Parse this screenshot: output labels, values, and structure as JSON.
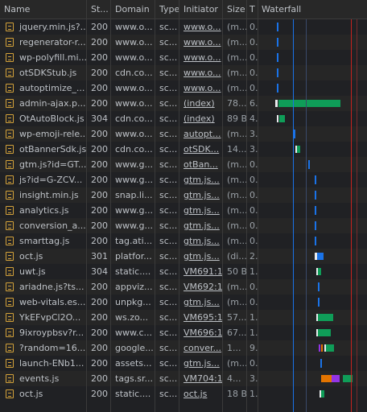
{
  "columns": {
    "name": "Name",
    "status": "St...",
    "domain": "Domain",
    "type": "Type",
    "initiator": "Initiator",
    "size": "Size",
    "time": "T",
    "waterfall": "Waterfall"
  },
  "colors": {
    "green": "#0f9d58",
    "blue": "#1a73e8",
    "wait": "#e8eaed",
    "orange": "#e37400",
    "purple": "#9334e6",
    "red": "#c5221f"
  },
  "rows": [
    {
      "name": "jquery.min.js?...",
      "status": "200",
      "domain": "www.o...",
      "type": "sc...",
      "initiator": "www.o...",
      "size": "(m...",
      "time": "0...",
      "link": true
    },
    {
      "name": "regenerator-r...",
      "status": "200",
      "domain": "www.o...",
      "type": "sc...",
      "initiator": "www.o...",
      "size": "(m...",
      "time": "0...",
      "link": true
    },
    {
      "name": "wp-polyfill.mi...",
      "status": "200",
      "domain": "www.o...",
      "type": "sc...",
      "initiator": "www.o...",
      "size": "(m...",
      "time": "0...",
      "link": true
    },
    {
      "name": "otSDKStub.js",
      "status": "200",
      "domain": "cdn.co...",
      "type": "sc...",
      "initiator": "www.o...",
      "size": "(m...",
      "time": "0...",
      "link": true
    },
    {
      "name": "autoptimize_...",
      "status": "200",
      "domain": "www.o...",
      "type": "sc...",
      "initiator": "www.o...",
      "size": "(m...",
      "time": "0...",
      "link": true
    },
    {
      "name": "admin-ajax.p...",
      "status": "200",
      "domain": "www.o...",
      "type": "sc...",
      "initiator": "(index)",
      "size": "78...",
      "time": "6...",
      "link": true
    },
    {
      "name": "OtAutoBlock.js",
      "status": "304",
      "domain": "cdn.co...",
      "type": "sc...",
      "initiator": "(index)",
      "size": "89 B",
      "time": "4...",
      "link": true
    },
    {
      "name": "wp-emoji-rele...",
      "status": "200",
      "domain": "www.o...",
      "type": "sc...",
      "initiator": "autopt...",
      "size": "(m...",
      "time": "3...",
      "link": true
    },
    {
      "name": "otBannerSdk.js",
      "status": "200",
      "domain": "cdn.co...",
      "type": "sc...",
      "initiator": "otSDK...",
      "size": "14...",
      "time": "3...",
      "link": true
    },
    {
      "name": "gtm.js?id=GT...",
      "status": "200",
      "domain": "www.g...",
      "type": "sc...",
      "initiator": "otBan...",
      "size": "(m...",
      "time": "0...",
      "link": true
    },
    {
      "name": "js?id=G-ZCV...",
      "status": "200",
      "domain": "www.g...",
      "type": "sc...",
      "initiator": "gtm.js...",
      "size": "(m...",
      "time": "0...",
      "link": true
    },
    {
      "name": "insight.min.js",
      "status": "200",
      "domain": "snap.li...",
      "type": "sc...",
      "initiator": "gtm.js...",
      "size": "(m...",
      "time": "0...",
      "link": true
    },
    {
      "name": "analytics.js",
      "status": "200",
      "domain": "www.g...",
      "type": "sc...",
      "initiator": "gtm.js...",
      "size": "(m...",
      "time": "0...",
      "link": true
    },
    {
      "name": "conversion_a...",
      "status": "200",
      "domain": "www.g...",
      "type": "sc...",
      "initiator": "gtm.js...",
      "size": "(m...",
      "time": "0...",
      "link": true
    },
    {
      "name": "smarttag.js",
      "status": "200",
      "domain": "tag.ati...",
      "type": "sc...",
      "initiator": "gtm.js...",
      "size": "(m...",
      "time": "0...",
      "link": true
    },
    {
      "name": "oct.js",
      "status": "301",
      "domain": "platfor...",
      "type": "sc...",
      "initiator": "gtm.js...",
      "size": "(di...",
      "time": "2...",
      "link": true
    },
    {
      "name": "uwt.js",
      "status": "304",
      "domain": "static....",
      "type": "sc...",
      "initiator": "VM691:1",
      "size": "50 B",
      "time": "1...",
      "link": true
    },
    {
      "name": "ariadne.js?ts...",
      "status": "200",
      "domain": "appviz...",
      "type": "sc...",
      "initiator": "VM692:1",
      "size": "(m...",
      "time": "0...",
      "link": true
    },
    {
      "name": "web-vitals.es...",
      "status": "200",
      "domain": "unpkg...",
      "type": "sc...",
      "initiator": "gtm.js...",
      "size": "(m...",
      "time": "0...",
      "link": true
    },
    {
      "name": "YkEFvpCl2O...",
      "status": "200",
      "domain": "ws.zo...",
      "type": "sc...",
      "initiator": "VM695:1",
      "size": "57...",
      "time": "1...",
      "link": true
    },
    {
      "name": "9ixroypbsv?r...",
      "status": "200",
      "domain": "www.c...",
      "type": "sc...",
      "initiator": "VM696:1",
      "size": "67...",
      "time": "1...",
      "link": true
    },
    {
      "name": "?random=16...",
      "status": "200",
      "domain": "google...",
      "type": "sc...",
      "initiator": "conver...",
      "size": "1...",
      "time": "9...",
      "link": true
    },
    {
      "name": "launch-ENb1...",
      "status": "200",
      "domain": "assets...",
      "type": "sc...",
      "initiator": "gtm.js...",
      "size": "(m...",
      "time": "0...",
      "link": true
    },
    {
      "name": "events.js",
      "status": "200",
      "domain": "tags.sr...",
      "type": "sc...",
      "initiator": "VM704:1",
      "size": "4...",
      "time": "3...",
      "link": true
    },
    {
      "name": "oct.js",
      "status": "200",
      "domain": "static....",
      "type": "sc...",
      "initiator": "oct.js",
      "size": "18 B",
      "time": "1...",
      "link": true
    }
  ]
}
